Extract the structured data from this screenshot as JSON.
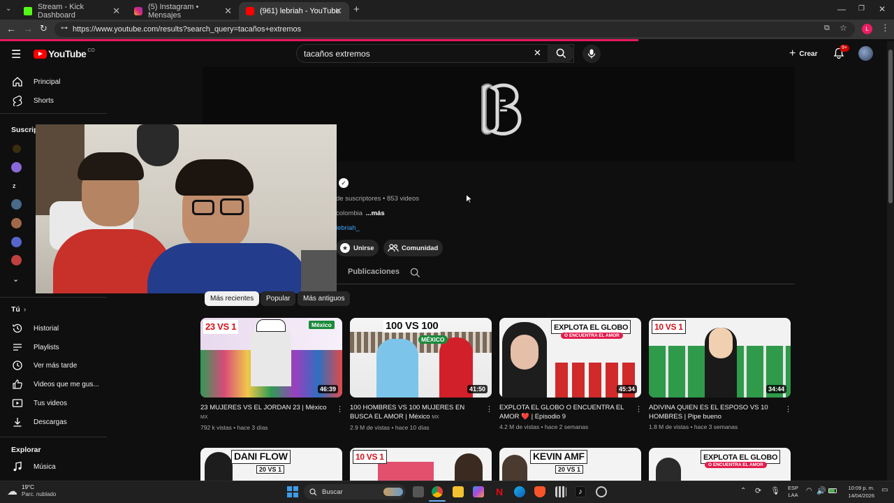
{
  "tabs": [
    {
      "label": "Stream - Kick Dashboard",
      "color": "#53fc18"
    },
    {
      "label": "(5) Instagram • Mensajes",
      "color": "#d62976"
    },
    {
      "label": "(961) lebriah - YouTube",
      "color": "#ff0000"
    }
  ],
  "address": {
    "url": "https://www.youtube.com/results?search_query=tacaños+extremos"
  },
  "yt": {
    "logo_text": "YouTube",
    "country": "CO",
    "search_value": "tacaños extremos",
    "create_label": "Crear",
    "notif_count": "9+"
  },
  "sidebar": {
    "top": [
      {
        "label": "Principal",
        "icon": "home-icon"
      },
      {
        "label": "Shorts",
        "icon": "shorts-icon"
      }
    ],
    "subs_header": "Suscrip",
    "you_header": "Tú",
    "you": [
      {
        "label": "Historial",
        "icon": "history-icon"
      },
      {
        "label": "Playlists",
        "icon": "playlist-icon"
      },
      {
        "label": "Ver más tarde",
        "icon": "clock-icon"
      },
      {
        "label": "Videos que me gus...",
        "icon": "like-icon"
      },
      {
        "label": "Tus videos",
        "icon": "video-icon"
      },
      {
        "label": "Descargas",
        "icon": "download-icon"
      }
    ],
    "explore_header": "Explorar",
    "explore": [
      {
        "label": "Música",
        "icon": "music-icon"
      }
    ]
  },
  "channel": {
    "stats": "de suscriptores • 853 videos",
    "desc": "colombia",
    "more": "...más",
    "link": "lebriah_",
    "join": "Unirse",
    "community": "Comunidad",
    "tab_posts": "Publicaciones"
  },
  "chips": [
    "Más recientes",
    "Popular",
    "Más antiguos"
  ],
  "videos": [
    {
      "title": "23 MUJERES VS EL JORDAN 23 | México",
      "title_suffix": "MX",
      "views": "792 k vistas",
      "ago": "hace 3 días",
      "duration": "46:39",
      "thumb_text": "23 VS 1",
      "thumb_badge": "México"
    },
    {
      "title": "100 HOMBRES VS 100 MUJERES EN BUSCA EL AMOR | México",
      "title_suffix": "MX",
      "views": "2.9 M de vistas",
      "ago": "hace 10 días",
      "duration": "41:50",
      "thumb_text": "100 VS 100",
      "thumb_badge": "MÉXICO"
    },
    {
      "title": "EXPLOTA EL GLOBO O ENCUENTRA EL AMOR ❤️ | Episodio 9",
      "title_suffix": "",
      "views": "4.2 M de vistas",
      "ago": "hace 2 semanas",
      "duration": "45:34",
      "thumb_text": "EXPLOTA EL GLOBO",
      "thumb_badge": "O ENCUENTRA EL AMOR"
    },
    {
      "title": "ADIVINA QUIEN ES EL ESPOSO VS 10 HOMBRES | Pipe bueno",
      "title_suffix": "",
      "views": "1.8 M de vistas",
      "ago": "hace 3 semanas",
      "duration": "34:44",
      "thumb_text": "10 VS 1",
      "thumb_badge": ""
    }
  ],
  "videos_row2": [
    {
      "thumb_text": "DANI FLOW",
      "thumb_badge": "20 VS 1"
    },
    {
      "thumb_text": "10 VS 1",
      "thumb_badge": ""
    },
    {
      "thumb_text": "KEVIN AMF",
      "thumb_badge": "20 VS 1"
    },
    {
      "thumb_text": "EXPLOTA EL GLOBO",
      "thumb_badge": "O ENCUENTRA EL AMOR"
    }
  ],
  "taskbar": {
    "weather_temp": "19°C",
    "weather_desc": "Parc. nublado",
    "search_label": "Buscar",
    "lang1": "ESP",
    "lang2": "LAA",
    "time": "10:09 p. m.",
    "date": "14/04/2026"
  }
}
